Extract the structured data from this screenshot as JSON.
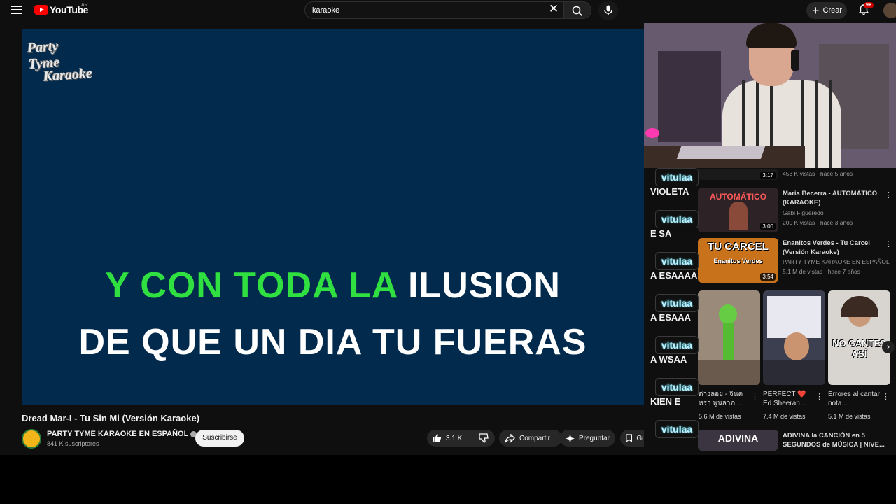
{
  "topbar": {
    "logo_text": "YouTube",
    "logo_country": "AR",
    "search_value": "karaoke",
    "create_label": "Crear",
    "notifications_badge": "9+"
  },
  "player": {
    "brand_logo_line1": "Party Tyme",
    "brand_logo_line2": "Karaoke",
    "lyric_line1_sung": "Y CON TODA LA",
    "lyric_line1_rest": " ILUSION",
    "lyric_line2": "DE QUE UN DIA TU FUERAS",
    "sung_color": "#2fe040",
    "background_color": "#022a4d"
  },
  "video": {
    "title": "Dread Mar-I - Tu Sin Mi (Versión Karaoke)",
    "channel_name": "PARTY TYME KARAOKE EN ESPAÑOL",
    "subscribers": "841 K suscriptores",
    "subscribe_label": "Suscribirse",
    "likes": "3.1 K",
    "share_label": "Compartir",
    "ask_label": "Preguntar",
    "save_label": "Guardar"
  },
  "chat": [
    {
      "user": "vitulaa",
      "message": "VIOLETA"
    },
    {
      "user": "vitulaa",
      "message": "E SA"
    },
    {
      "user": "vitulaa",
      "message": "A ESAAAA"
    },
    {
      "user": "vitulaa",
      "message": "A ESAAA"
    },
    {
      "user": "vitulaa",
      "message": "A WSAA"
    },
    {
      "user": "vitulaa",
      "message": "KIEN E"
    },
    {
      "user": "vitulaa",
      "message": ""
    }
  ],
  "recommendations": [
    {
      "title": "",
      "meta": "453 K vistas · hace 5 años",
      "duration": "3:17"
    },
    {
      "title": "Maria Becerra - AUTOMÁTICO (KARAOKE)",
      "channel": "Gabi Figueredo",
      "meta": "200 K vistas · hace 3 años",
      "duration": "3:00",
      "thumb_text": "AUTOMÁTICO"
    },
    {
      "title": "Enanitos Verdes - Tu Carcel (Versión Karaoke)",
      "channel": "PARTY TYME KARAOKE EN ESPAÑOL",
      "meta": "5.1 M de vistas · hace 7 años",
      "duration": "3:54",
      "thumb_text": "TU CARCEL",
      "thumb_sub": "Enanitos Verdes"
    },
    {
      "title": "ADIVINA la CANCIÓN en 5 SEGUNDOS de MÚSICA | NIVE...",
      "thumb_text": "ADIVINA"
    }
  ],
  "shorts": [
    {
      "title": "ต่างลอย - จินตหรา พูนลาภ ...",
      "views": "5.6 M de vistas"
    },
    {
      "title": "PERFECT ❤️ Ed Sheeran...",
      "views": "7.4 M de vistas"
    },
    {
      "title": "Errores al cantar nota...",
      "views": "5.1 M de vistas",
      "overlay": "NO CANTES ASÍ"
    }
  ]
}
